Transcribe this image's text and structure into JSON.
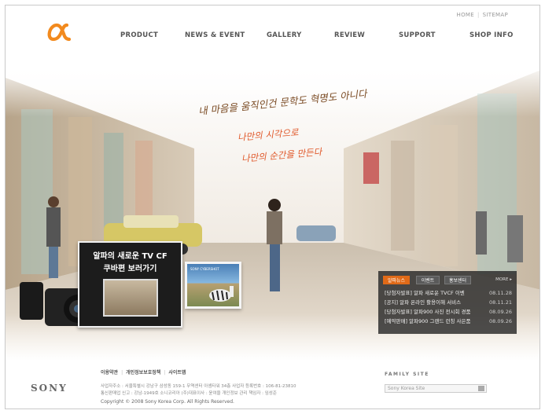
{
  "header": {
    "util_links": [
      "HOME",
      "SITEMAP"
    ],
    "logo": "α",
    "nav": [
      "PRODUCT",
      "NEWS & EVENT",
      "GALLERY",
      "REVIEW",
      "SUPPORT",
      "SHOP INFO"
    ]
  },
  "hero": {
    "slogans": [
      "내 마음을 움직인건 문학도 혁명도 아니다",
      "나만의 시각으로",
      "나만의 순간을 만든다"
    ],
    "cf_banner": {
      "line1": "알파의 새로운 TV CF",
      "line2": "쿠바편 보러가기"
    },
    "thumb_label": "SONY CYBERSHOT"
  },
  "news": {
    "tabs": [
      "알파뉴스",
      "이벤트",
      "홍보센터"
    ],
    "more": "MORE ▸",
    "items": [
      {
        "title": "[당첨자발표] 알파 새로운 TVCF 이벤",
        "date": "08.11.28"
      },
      {
        "title": "[공지] 알파 온라인 활용이해 서비스",
        "date": "08.11.21"
      },
      {
        "title": "[당첨자발표] 알파900 사진 전시회 경품",
        "date": "08.09.26"
      },
      {
        "title": "[예약판매] 알파900 그랜드 런칭 사은품",
        "date": "08.09.26"
      }
    ]
  },
  "footer": {
    "brand": "SONY",
    "links": [
      "이용약관",
      "개인정보보호정책",
      "사이트맵"
    ],
    "info_line1": "사업자주소 : 서울특별시 강남구 삼성동 159-1 무역센터 아셈타워 34층   사업자 등록번호 : 106-81-23810",
    "info_line2": "통신판매업 신고 : 강남-1949호   소니코리아 (주)대표이사 : 윤여을   개인정보 관리 책임자 : 임성준",
    "copyright": "Copyright © 2008 Sony Korea Corp. All Rights Reserved.",
    "family_label": "FAMILY SITE",
    "family_select": "Sony Korea Site"
  },
  "colors": {
    "accent": "#e0582a",
    "brand_orange": "#f28a1e",
    "tab_active": "#e06a18"
  }
}
